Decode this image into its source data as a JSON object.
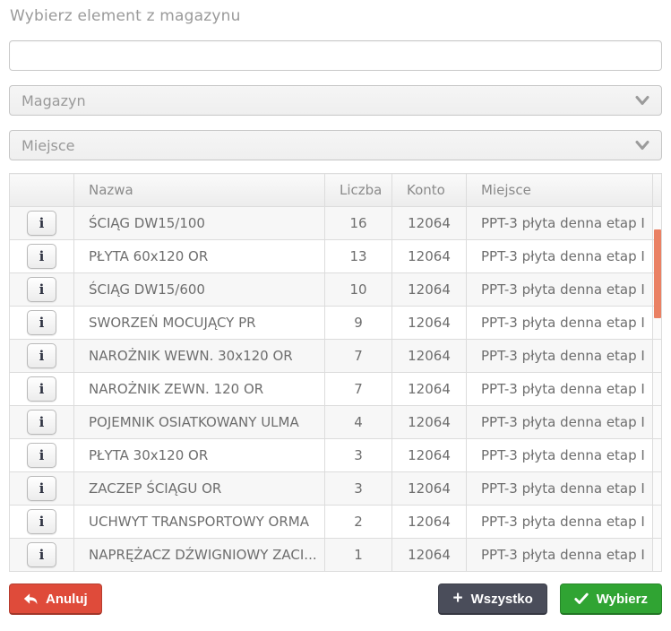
{
  "page": {
    "title": "Wybierz element z magazynu"
  },
  "search": {
    "value": "",
    "placeholder": ""
  },
  "filters": {
    "magazyn": {
      "label": "Magazyn"
    },
    "miejsce": {
      "label": "Miejsce"
    }
  },
  "table": {
    "columns": {
      "info": "",
      "name": "Nazwa",
      "count": "Liczba",
      "account": "Konto",
      "place": "Miejsce"
    },
    "info_glyph": "i",
    "scrollbar_color": "#ea8164",
    "rows": [
      {
        "name": "ŚCIĄG DW15/100",
        "count": "16",
        "account": "12064",
        "place": "PPT-3 płyta denna etap I"
      },
      {
        "name": "PŁYTA 60x120 OR",
        "count": "13",
        "account": "12064",
        "place": "PPT-3 płyta denna etap I"
      },
      {
        "name": "ŚCIĄG DW15/600",
        "count": "10",
        "account": "12064",
        "place": "PPT-3 płyta denna etap I"
      },
      {
        "name": "SWORZEŃ MOCUJĄCY PR",
        "count": "9",
        "account": "12064",
        "place": "PPT-3 płyta denna etap I"
      },
      {
        "name": "NAROŻNIK WEWN. 30x120 OR",
        "count": "7",
        "account": "12064",
        "place": "PPT-3 płyta denna etap I"
      },
      {
        "name": "NAROŻNIK ZEWN. 120 OR",
        "count": "7",
        "account": "12064",
        "place": "PPT-3 płyta denna etap I"
      },
      {
        "name": "POJEMNIK OSIATKOWANY ULMA",
        "count": "4",
        "account": "12064",
        "place": "PPT-3 płyta denna etap I"
      },
      {
        "name": "PŁYTA 30x120 OR",
        "count": "3",
        "account": "12064",
        "place": "PPT-3 płyta denna etap I"
      },
      {
        "name": "ZACZEP ŚCIĄGU OR",
        "count": "3",
        "account": "12064",
        "place": "PPT-3 płyta denna etap I"
      },
      {
        "name": "UCHWYT TRANSPORTOWY ORMA",
        "count": "2",
        "account": "12064",
        "place": "PPT-3 płyta denna etap I"
      },
      {
        "name": "NAPRĘŻACZ DŹWIGNIOWY ZACI...",
        "count": "1",
        "account": "12064",
        "place": "PPT-3 płyta denna etap I"
      }
    ]
  },
  "actions": {
    "cancel": {
      "label": "Anuluj",
      "color": "#df4b3a"
    },
    "all": {
      "label": "Wszystko",
      "color": "#4a4d5a"
    },
    "select": {
      "label": "Wybierz",
      "color": "#30a433"
    }
  }
}
